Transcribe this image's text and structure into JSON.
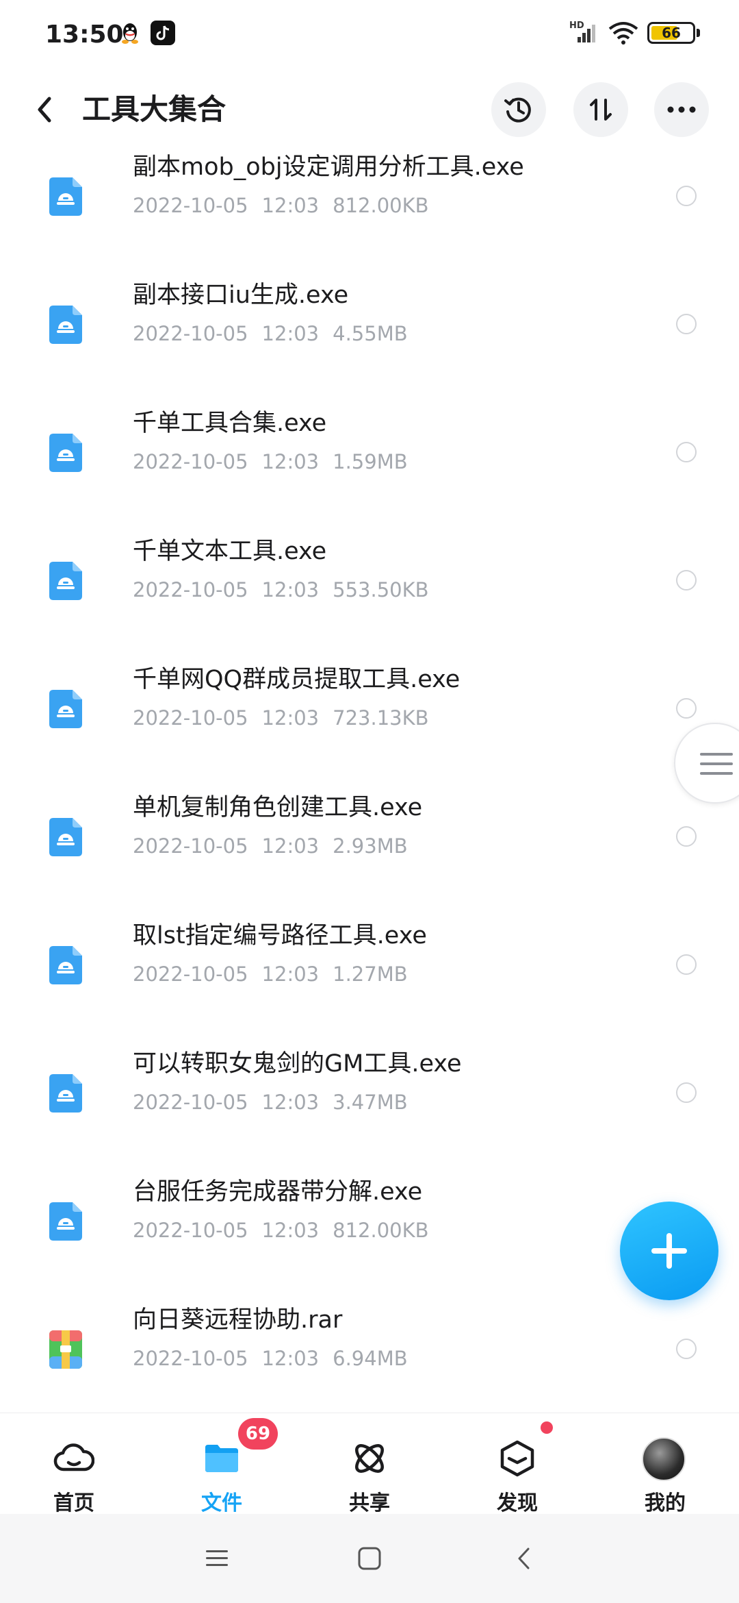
{
  "status_bar": {
    "time": "13:50",
    "network_label": "HD",
    "battery_level": "66",
    "battery_fraction": 0.66,
    "icons": [
      "qq-icon",
      "tiktok-icon",
      "signal-icon",
      "wifi-icon",
      "battery-icon"
    ]
  },
  "header": {
    "title": "工具大集合",
    "icons": [
      "back-icon",
      "history-icon",
      "sort-icon",
      "more-icon"
    ]
  },
  "files": [
    {
      "name": "副本mob_obj设定调用分析工具.exe",
      "date": "2022-10-05",
      "time": "12:03",
      "size": "812.00KB",
      "type": "exe"
    },
    {
      "name": "副本接口iu生成.exe",
      "date": "2022-10-05",
      "time": "12:03",
      "size": "4.55MB",
      "type": "exe"
    },
    {
      "name": "千单工具合集.exe",
      "date": "2022-10-05",
      "time": "12:03",
      "size": "1.59MB",
      "type": "exe"
    },
    {
      "name": "千单文本工具.exe",
      "date": "2022-10-05",
      "time": "12:03",
      "size": "553.50KB",
      "type": "exe"
    },
    {
      "name": "千单网QQ群成员提取工具.exe",
      "date": "2022-10-05",
      "time": "12:03",
      "size": "723.13KB",
      "type": "exe"
    },
    {
      "name": "单机复制角色创建工具.exe",
      "date": "2022-10-05",
      "time": "12:03",
      "size": "2.93MB",
      "type": "exe"
    },
    {
      "name": "取lst指定编号路径工具.exe",
      "date": "2022-10-05",
      "time": "12:03",
      "size": "1.27MB",
      "type": "exe"
    },
    {
      "name": "可以转职女鬼剑的GM工具.exe",
      "date": "2022-10-05",
      "time": "12:03",
      "size": "3.47MB",
      "type": "exe"
    },
    {
      "name": "台服任务完成器带分解.exe",
      "date": "2022-10-05",
      "time": "12:03",
      "size": "812.00KB",
      "type": "exe"
    },
    {
      "name": "向日葵远程协助.rar",
      "date": "2022-10-05",
      "time": "12:03",
      "size": "6.94MB",
      "type": "rar"
    }
  ],
  "bottom_nav": {
    "items": [
      {
        "label": "首页",
        "icon": "cloud-icon",
        "active": false
      },
      {
        "label": "文件",
        "icon": "folder-icon",
        "active": true
      },
      {
        "label": "共享",
        "icon": "share-atom-icon",
        "active": false
      },
      {
        "label": "发现",
        "icon": "discover-box-icon",
        "active": false
      },
      {
        "label": "我的",
        "icon": "avatar",
        "active": false
      }
    ],
    "share_badge": "69"
  },
  "colors": {
    "accent": "#15a3f5",
    "badge": "#f1435d",
    "exe_icon": "#3aa3f2",
    "meta_text": "#a3a7ad"
  }
}
